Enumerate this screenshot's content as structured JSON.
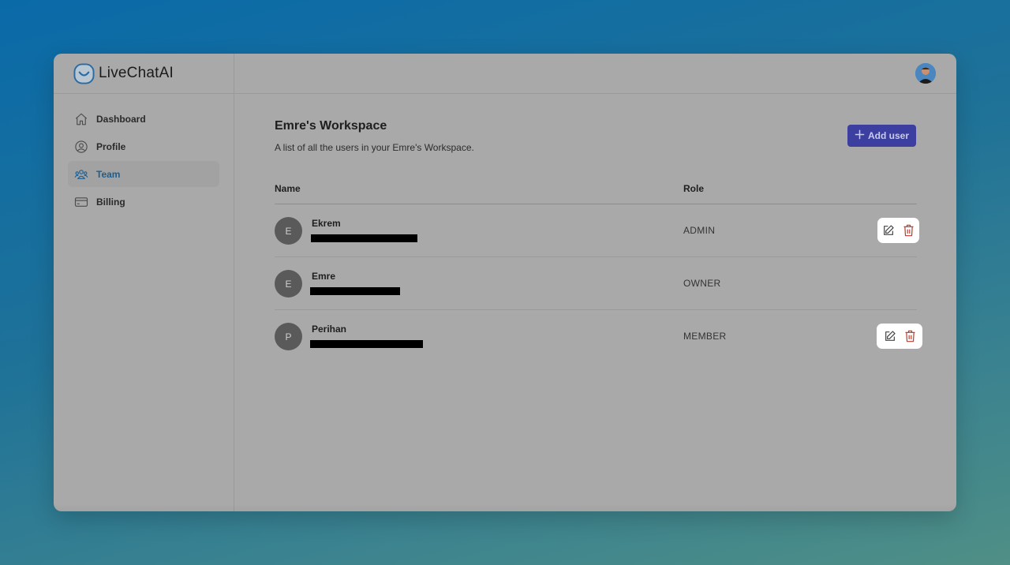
{
  "app": {
    "name": "LiveChatAI"
  },
  "sidebar": {
    "items": [
      {
        "label": "Dashboard",
        "icon": "home-icon",
        "active": false
      },
      {
        "label": "Profile",
        "icon": "user-circle-icon",
        "active": false
      },
      {
        "label": "Team",
        "icon": "users-icon",
        "active": true
      },
      {
        "label": "Billing",
        "icon": "credit-card-icon",
        "active": false
      }
    ]
  },
  "header": {
    "avatar": "user-avatar"
  },
  "workspace": {
    "title": "Emre's Workspace",
    "subtitle": "A list of all the users in your Emre's Workspace.",
    "add_user_label": "Add user"
  },
  "table": {
    "columns": [
      "Name",
      "Role"
    ],
    "rows": [
      {
        "initial": "E",
        "name": "Ekrem",
        "role": "ADMIN",
        "editable": true
      },
      {
        "initial": "E",
        "name": "Emre",
        "role": "OWNER",
        "editable": false
      },
      {
        "initial": "P",
        "name": "Perihan",
        "role": "MEMBER",
        "editable": true
      }
    ]
  },
  "colors": {
    "accent": "#3c3fa0",
    "active_nav": "#1d5e90",
    "delete": "#c0392b"
  }
}
